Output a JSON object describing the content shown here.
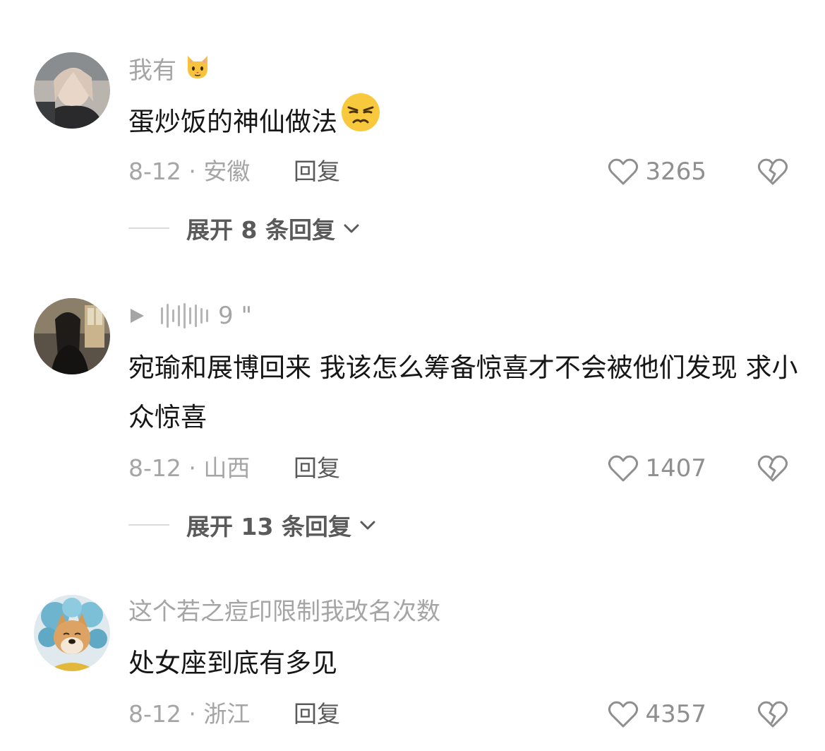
{
  "comments": [
    {
      "username": "我有",
      "username_emoji": "cat-face-icon",
      "text": "蛋炒饭的神仙做法",
      "text_emoji": "unamused-face-icon",
      "meta": "8-12 · 安徽",
      "reply_label": "回复",
      "likes": "3265",
      "expand_label": "展开 8 条回复"
    },
    {
      "voice_duration": "9 \"",
      "text": "宛瑜和展博回来 我该怎么筹备惊喜才不会被他们发现 求小众惊喜",
      "meta": "8-12 · 山西",
      "reply_label": "回复",
      "likes": "1407",
      "expand_label": "展开 13 条回复"
    },
    {
      "username": "这个若之痘印限制我改名次数",
      "text": "处女座到底有多见",
      "meta": "8-12 · 浙江",
      "reply_label": "回复",
      "likes": "4357"
    }
  ],
  "colors": {
    "primary_text": "#161616",
    "secondary_text": "#a5a5a5",
    "action_text": "#5a5a5a"
  }
}
